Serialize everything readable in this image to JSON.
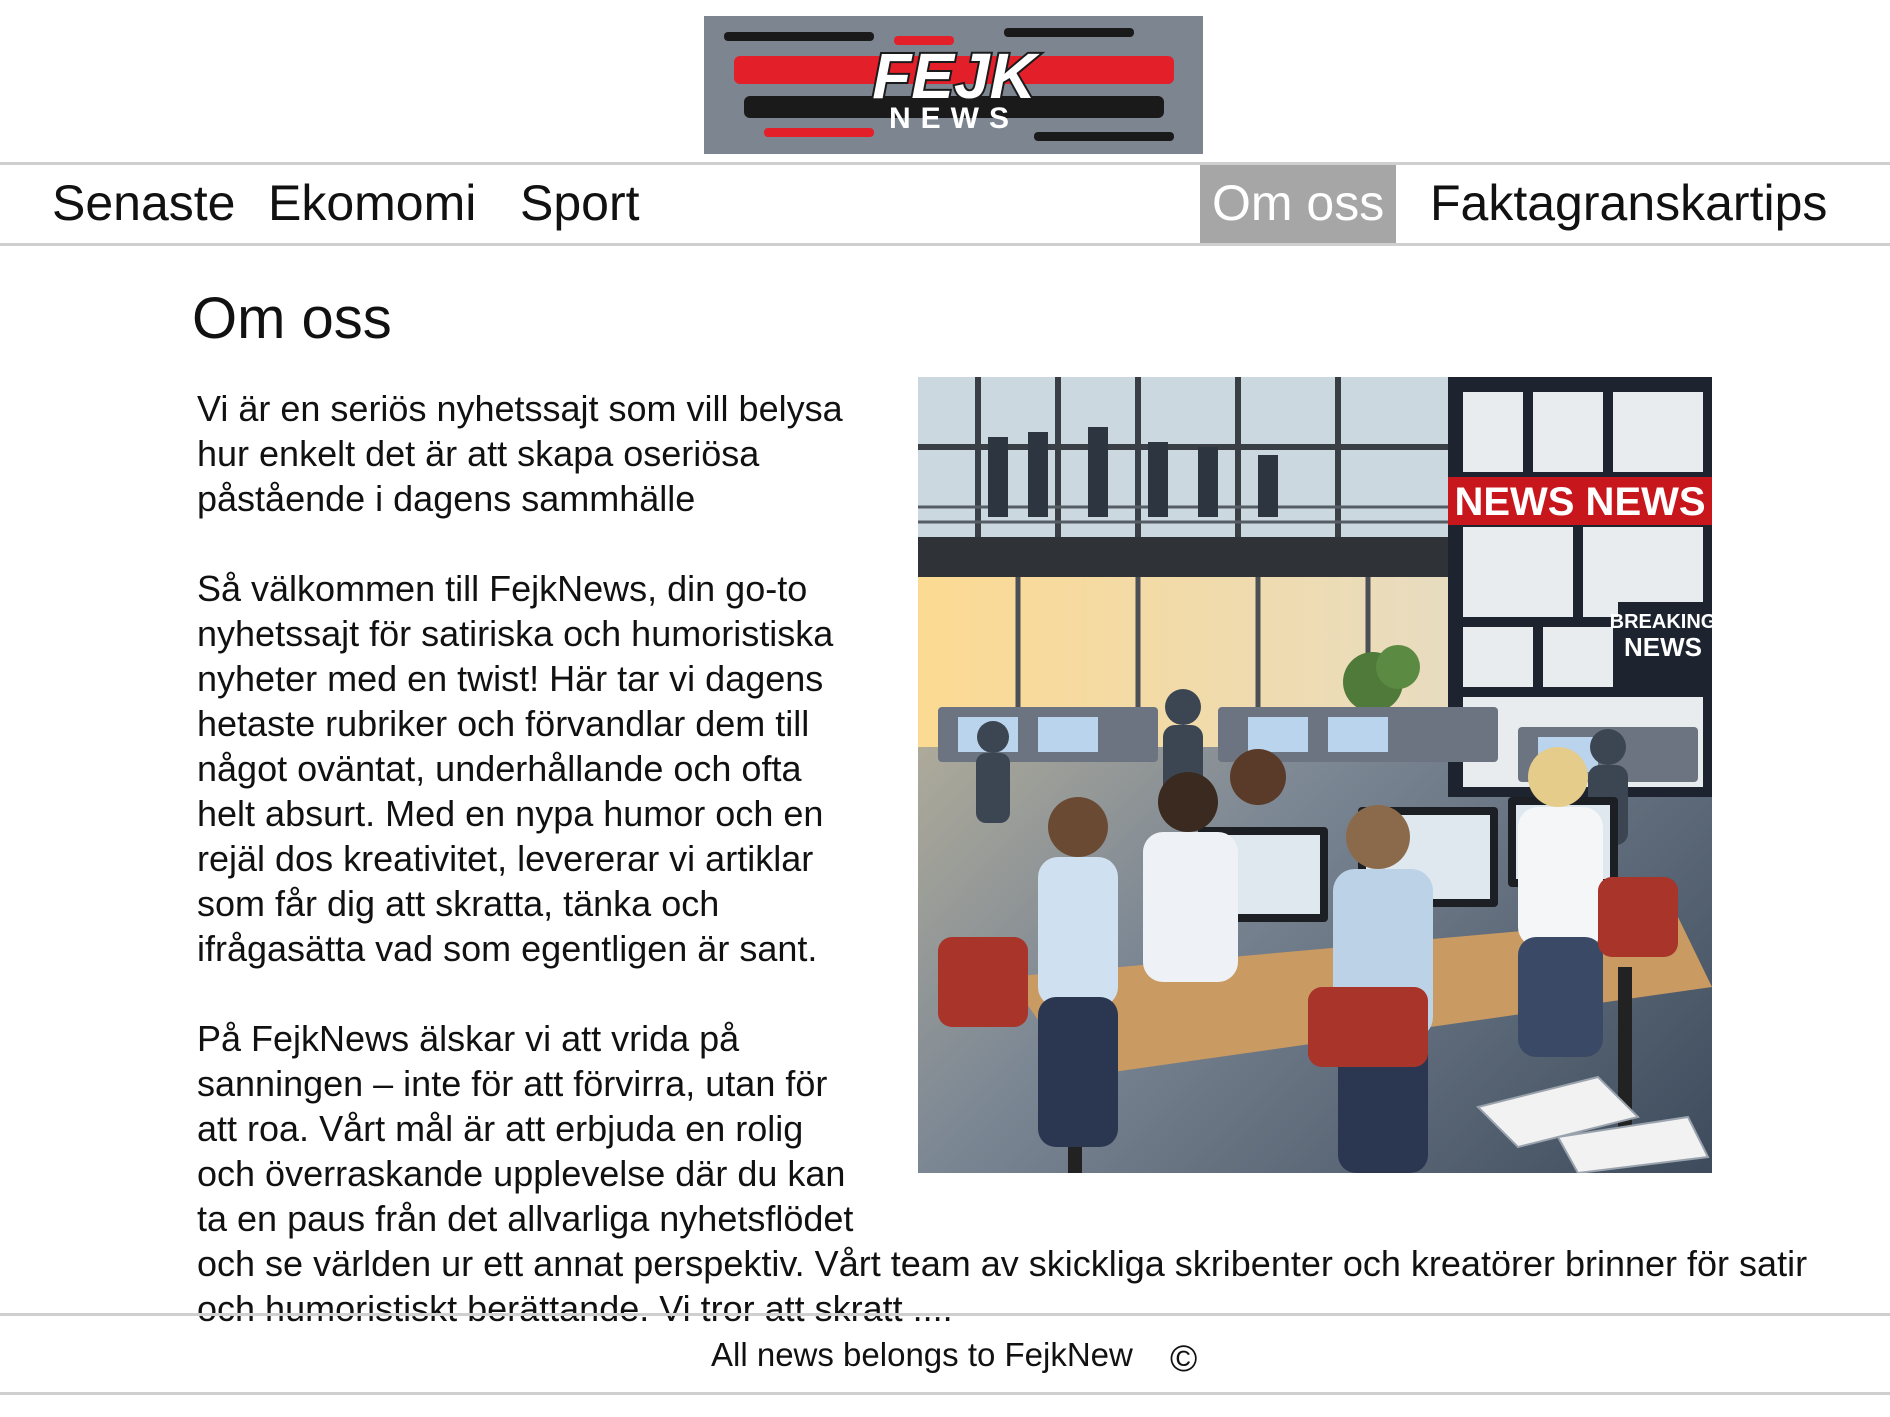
{
  "logo": {
    "title": "FEJK",
    "subtitle": "NEWS",
    "icon": "fejk-news-logo-icon",
    "colors": {
      "red": "#e3202a",
      "dark": "#1a1a1a",
      "white": "#ffffff"
    }
  },
  "nav": {
    "items": [
      {
        "label": "Senaste"
      },
      {
        "label": "Ekomomi"
      },
      {
        "label": "Sport"
      },
      {
        "label": "Om oss",
        "active": true
      },
      {
        "label": "Faktagranskartips"
      }
    ],
    "active_color": "#a6a6a6"
  },
  "page": {
    "title": "Om oss",
    "paragraphs": [
      "Vi är en seriös nyhetssajt som vill belysa hur enkelt det är att skapa oseriösa påstående i dagens sammhälle",
      "Så välkommen till FejkNews, din go-to nyhetssajt för satiriska och humoristiska nyheter med en twist! Här tar vi dagens hetaste rubriker och förvandlar dem till något oväntat, underhållande och ofta helt absurt. Med en nypa humor och en rejäl dos kreativitet, levererar vi artiklar som får dig att skratta, tänka och ifrågasätta vad som egentligen är sant.",
      "På FejkNews älskar vi att vrida på sanningen – inte för att förvirra, utan för att roa. Vårt mål är att erbjuda en rolig och överraskande upplevelse där du kan ta en paus från det allvarliga nyhetsflödet och se världen ur ett annat perspektiv. Vårt team av skickliga skribenter och kreatörer brinner för satir och humoristiskt berättande. Vi tror att skratt ...."
    ],
    "image": {
      "icon": "newsroom-image",
      "signs": [
        "NEWS NEWS",
        "BREAKING",
        "NEWS"
      ]
    }
  },
  "footer": {
    "text": "All news belongs to FejkNew",
    "icon": "copyright-icon",
    "symbol": "©"
  }
}
